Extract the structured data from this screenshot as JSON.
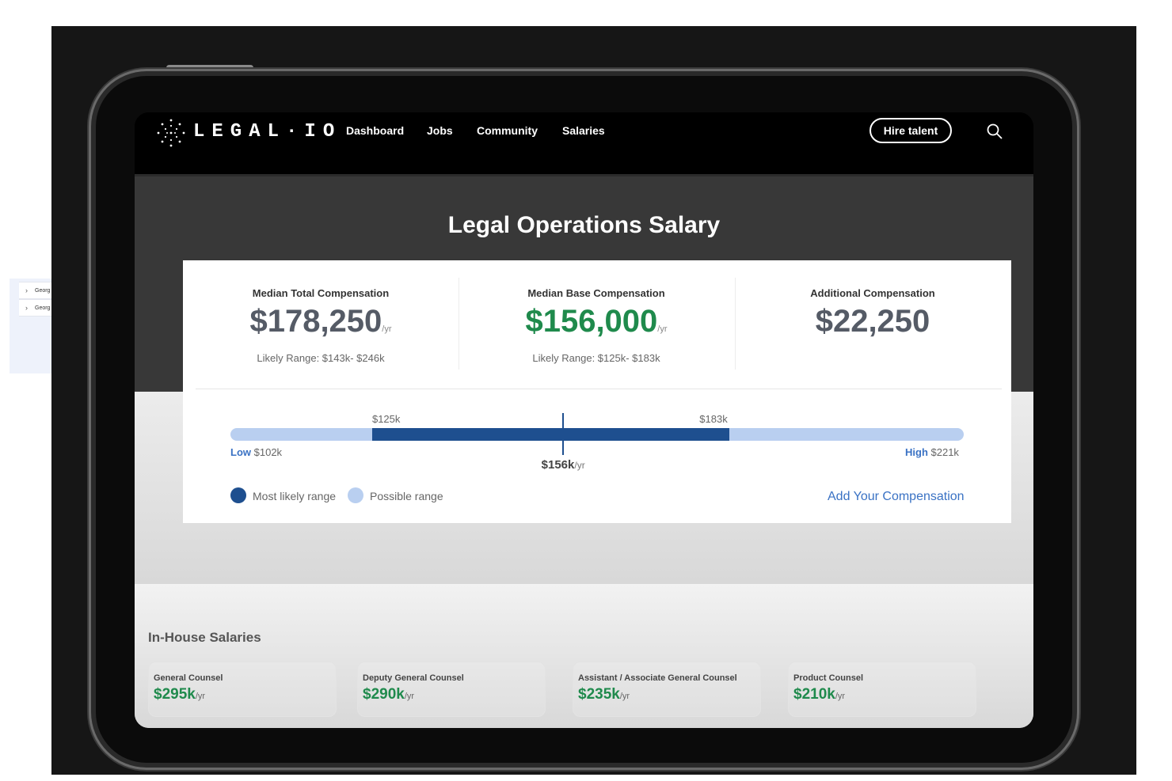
{
  "sidebar": {
    "rows": [
      {
        "label": "Georg"
      },
      {
        "label": "Georg"
      }
    ]
  },
  "nav": {
    "logo_text": "LEGAL·IO",
    "links": [
      "Dashboard",
      "Jobs",
      "Community",
      "Salaries"
    ],
    "hire_button": "Hire talent"
  },
  "page": {
    "title": "Legal Operations Salary"
  },
  "stats": [
    {
      "label": "Median Total Compensation",
      "value": "$178,250",
      "unit": "/yr",
      "range": "Likely Range: $143k- $246k",
      "color": "#555b66"
    },
    {
      "label": "Median Base Compensation",
      "value": "$156,000",
      "unit": "/yr",
      "range": "Likely Range: $125k- $183k",
      "color": "#1f8a4c"
    },
    {
      "label": "Additional Compensation",
      "value": "$22,250",
      "unit": "",
      "range": "",
      "color": "#555b66"
    }
  ],
  "range_bar": {
    "low_label": "Low",
    "low_value": "$102k",
    "high_label": "High",
    "high_value": "$221k",
    "likely_low": "$125k",
    "likely_high": "$183k",
    "median": "$156k",
    "median_unit": "/yr",
    "low_k": 102,
    "high_k": 221,
    "likely_low_k": 125,
    "likely_high_k": 183,
    "median_k": 156,
    "colors": {
      "possible": "#b9cff0",
      "likely": "#1e4f8f"
    }
  },
  "legend": {
    "most_likely": "Most likely range",
    "possible": "Possible range"
  },
  "add_compensation": "Add Your Compensation",
  "in_house": {
    "title": "In-House Salaries",
    "roles": [
      {
        "name": "General Counsel",
        "value": "$295k",
        "unit": "/yr"
      },
      {
        "name": "Deputy General Counsel",
        "value": "$290k",
        "unit": "/yr"
      },
      {
        "name": "Assistant / Associate General Counsel",
        "value": "$235k",
        "unit": "/yr"
      },
      {
        "name": "Product Counsel",
        "value": "$210k",
        "unit": "/yr"
      }
    ]
  }
}
